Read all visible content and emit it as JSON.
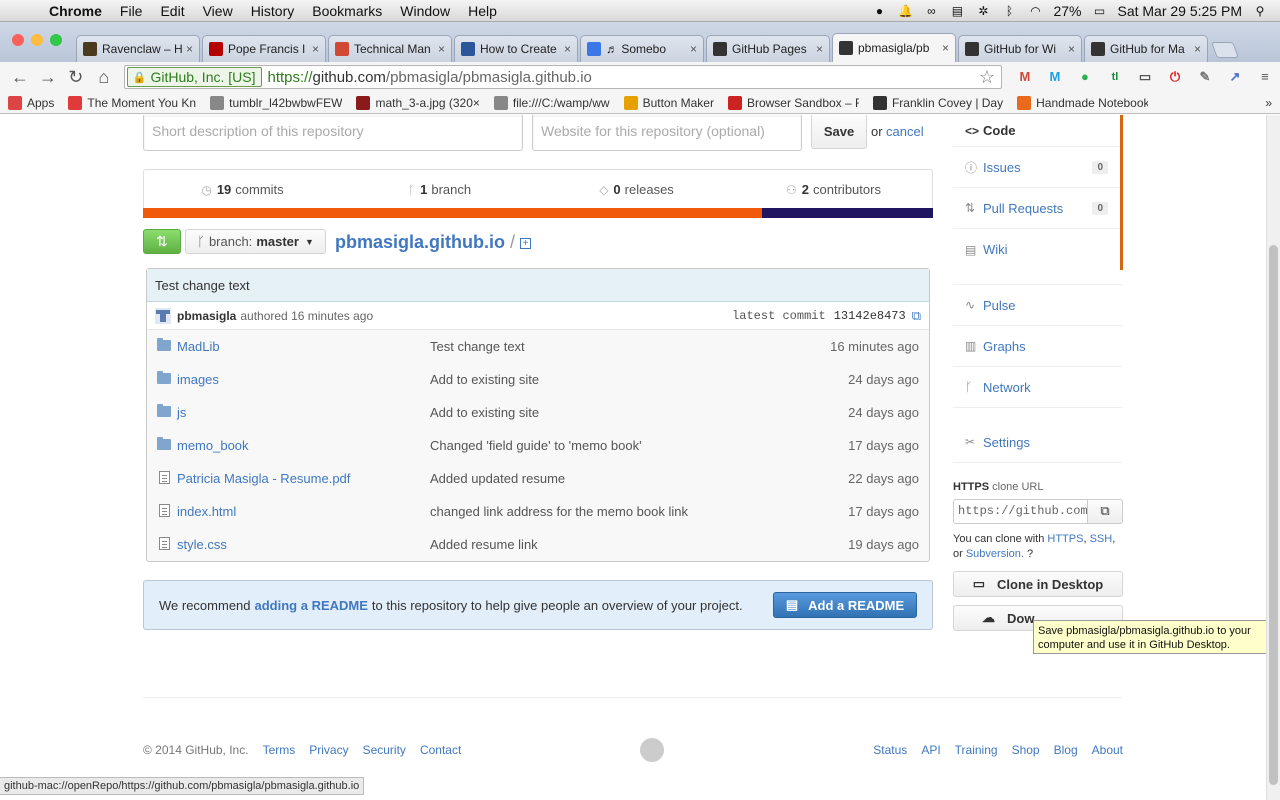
{
  "mac_menu": {
    "app": "Chrome",
    "items": [
      "File",
      "Edit",
      "View",
      "History",
      "Bookmarks",
      "Window",
      "Help"
    ],
    "battery": "27%",
    "datetime": "Sat Mar 29  5:25 PM"
  },
  "tabs": [
    {
      "title": "Ravenclaw – H",
      "color": "#4a3a20"
    },
    {
      "title": "Pope Francis I",
      "color": "#b30000"
    },
    {
      "title": "Technical Man",
      "color": "#d14836"
    },
    {
      "title": "How to Create",
      "color": "#2b579a"
    },
    {
      "title": "♬ Somebo",
      "color": "#3b78e7"
    },
    {
      "title": "GitHub Pages",
      "color": "#333333"
    },
    {
      "title": "pbmasigla/pb",
      "color": "#333333",
      "active": true
    },
    {
      "title": "GitHub for Wi",
      "color": "#333333"
    },
    {
      "title": "GitHub for Ma",
      "color": "#333333"
    }
  ],
  "toolbar": {
    "ev_label": "GitHub, Inc. [US]",
    "url_scheme": "https://",
    "url_host": "github.com",
    "url_path": "/pbmasigla/pbmasigla.github.io"
  },
  "bookmarks": [
    {
      "label": "Apps",
      "color": "#d44"
    },
    {
      "label": "The Moment You Kn",
      "color": "#e03a3a"
    },
    {
      "label": "tumblr_l42bwbwFEW",
      "color": "#888888"
    },
    {
      "label": "math_3-a.jpg (320×",
      "color": "#8b1a1a"
    },
    {
      "label": "file:///C:/wamp/ww",
      "color": "#888888"
    },
    {
      "label": "Button Maker",
      "color": "#e6a100"
    },
    {
      "label": "Browser Sandbox – F",
      "color": "#cc2222"
    },
    {
      "label": "Franklin Covey | Day",
      "color": "#333333"
    },
    {
      "label": "Handmade Notebook",
      "color": "#e86a1a"
    }
  ],
  "repo_form": {
    "description_placeholder": "Short description of this repository",
    "website_placeholder": "Website for this repository (optional)",
    "save_label": "Save",
    "or_text": "or",
    "cancel_label": "cancel"
  },
  "summary": {
    "commits_count": "19",
    "commits_label": "commits",
    "branch_count": "1",
    "branch_label": "branch",
    "releases_count": "0",
    "releases_label": "releases",
    "contributors_count": "2",
    "contributors_label": "contributors"
  },
  "language_bar": [
    {
      "share": 78.4,
      "color": "#f05a0a"
    },
    {
      "share": 21.6,
      "color": "#1f1560"
    }
  ],
  "branch_bar": {
    "branch_prefix": "branch:",
    "branch_name": "master",
    "repo_name": "pbmasigla.github.io",
    "separator": "/"
  },
  "commit": {
    "message": "Test change text",
    "author": "pbmasigla",
    "authored_text": "authored 16 minutes ago",
    "latest_label": "latest commit",
    "sha": "13142e8473"
  },
  "files": [
    {
      "type": "dir",
      "name": "MadLib",
      "message": "Test change text",
      "age": "16 minutes ago"
    },
    {
      "type": "dir",
      "name": "images",
      "message": "Add to existing site",
      "age": "24 days ago"
    },
    {
      "type": "dir",
      "name": "js",
      "message": "Add to existing site",
      "age": "24 days ago"
    },
    {
      "type": "dir",
      "name": "memo_book",
      "message": "Changed 'field guide' to 'memo book'",
      "age": "17 days ago"
    },
    {
      "type": "file",
      "name": "Patricia Masigla - Resume.pdf",
      "message": "Added updated resume",
      "age": "22 days ago"
    },
    {
      "type": "file",
      "name": "index.html",
      "message": "changed link address for the memo book link",
      "age": "17 days ago"
    },
    {
      "type": "file",
      "name": "style.css",
      "message": "Added resume link",
      "age": "19 days ago"
    }
  ],
  "readme": {
    "before": "We recommend",
    "link": "adding a README",
    "after": "to this repository to help give people an overview of your project.",
    "button": "Add a README"
  },
  "sidebar": {
    "code": "Code",
    "issues": "Issues",
    "issues_count": "0",
    "pulls": "Pull Requests",
    "pulls_count": "0",
    "wiki": "Wiki",
    "pulse": "Pulse",
    "graphs": "Graphs",
    "network": "Network",
    "settings": "Settings",
    "clone_heading_bold": "HTTPS",
    "clone_heading_rest": "clone URL",
    "clone_url": "https://github.com",
    "clone_help_1": "You can clone with",
    "https_link": "HTTPS",
    "ssh_link": "SSH",
    "clone_help_2": "or",
    "svn_link": "Subversion.",
    "clone_desktop": "Clone in Desktop",
    "download_partial": "Dow"
  },
  "tooltip": "Save pbmasigla/pbmasigla.github.io to your computer and use it in GitHub Desktop.",
  "footer": {
    "copyright": "© 2014 GitHub, Inc.",
    "left_links": [
      "Terms",
      "Privacy",
      "Security",
      "Contact"
    ],
    "right_links": [
      "Status",
      "API",
      "Training",
      "Shop",
      "Blog",
      "About"
    ]
  },
  "statusbar": "github-mac://openRepo/https://github.com/pbmasigla/pbmasigla.github.io"
}
